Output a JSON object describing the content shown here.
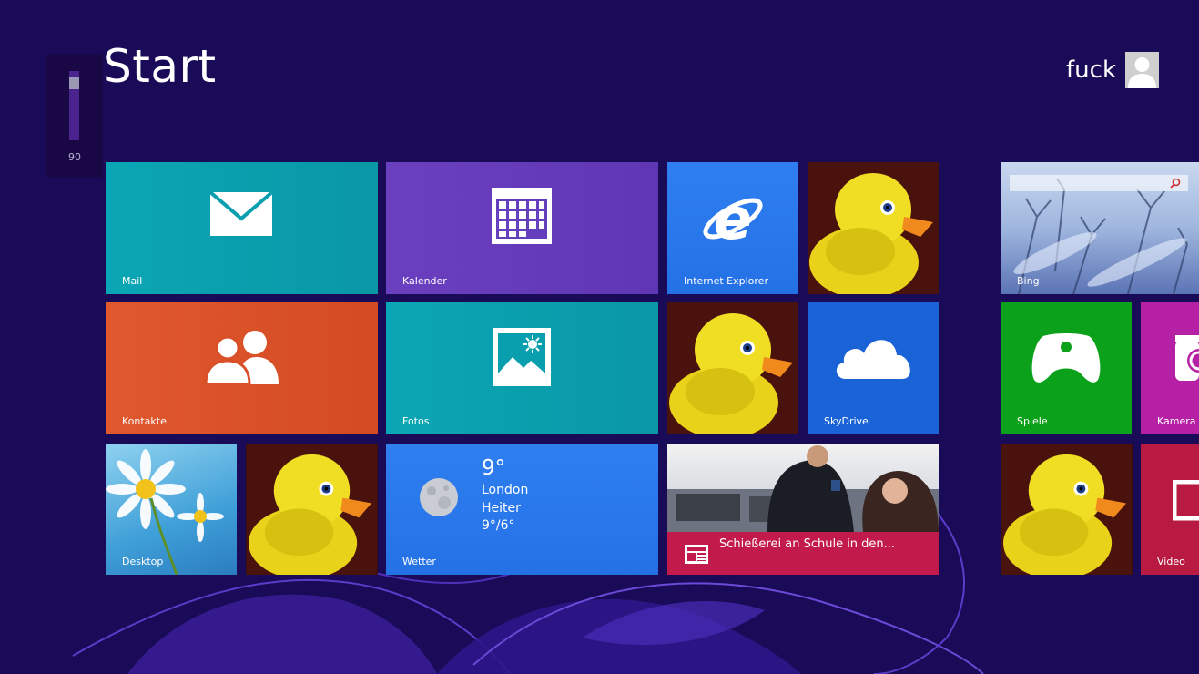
{
  "screen": {
    "title": "Start",
    "background": "#1a0b59"
  },
  "user": {
    "name": "fuck"
  },
  "volume": {
    "level": 90,
    "fraction": 0.9
  },
  "tiles": {
    "mail": {
      "label": "Mail",
      "icon": "mail-icon",
      "color": "#0ba6b5"
    },
    "calendar": {
      "label": "Kalender",
      "icon": "calendar-icon",
      "color": "#6a40c0"
    },
    "ie": {
      "label": "Internet Explorer",
      "icon": "internet-explorer-icon",
      "color": "#2f7ff0"
    },
    "contacts": {
      "label": "Kontakte",
      "icon": "people-icon",
      "color": "#e0582e"
    },
    "photos": {
      "label": "Fotos",
      "icon": "photos-icon",
      "color": "#0ba6b5"
    },
    "skydrive": {
      "label": "SkyDrive",
      "icon": "cloud-icon",
      "color": "#1a63d6"
    },
    "desktop": {
      "label": "Desktop"
    },
    "weather": {
      "label": "Wetter",
      "temperature": "9°",
      "city": "London",
      "condition": "Heiter",
      "range": "9°/6°",
      "icon": "moon-icon",
      "color": "#2f7ff0"
    },
    "news": {
      "headline": "Schießerei an Schule in den...",
      "icon": "news-icon",
      "color": "#c21a4b"
    },
    "bing": {
      "label": "Bing",
      "icon": "search-icon"
    },
    "games": {
      "label": "Spiele",
      "icon": "gamepad-icon",
      "color": "#0ca11a"
    },
    "camera": {
      "label": "Kamera",
      "icon": "camera-icon",
      "color": "#b620a4"
    },
    "video": {
      "label": "Video",
      "icon": "video-icon",
      "color": "#b81a42"
    }
  }
}
